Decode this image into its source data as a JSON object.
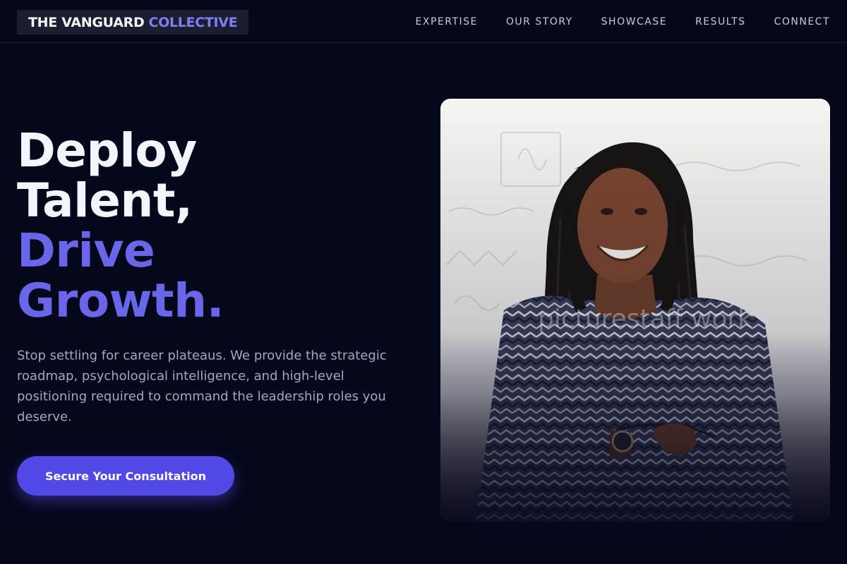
{
  "brand": {
    "name": "THE VANGUARD",
    "accent": "COLLECTIVE"
  },
  "nav": {
    "links": [
      {
        "label": "EXPERTISE"
      },
      {
        "label": "OUR STORY"
      },
      {
        "label": "SHOWCASE"
      },
      {
        "label": "RESULTS"
      },
      {
        "label": "CONNECT"
      }
    ]
  },
  "hero": {
    "title_lines": [
      "Deploy",
      "Talent,",
      "Drive",
      "Growth."
    ],
    "subtitle": "Stop settling for career plateaus. We provide the strategic roadmap, psychological intelligence, and high-level positioning required to command the leadership roles you deserve.",
    "cta_label": "Secure Your Consultation"
  },
  "image": {
    "watermark": "picturestaff work"
  },
  "colors": {
    "background": "#05071a",
    "accent": "#6a66ea",
    "button": "#5248e6",
    "text_muted": "#a4a8bd"
  }
}
